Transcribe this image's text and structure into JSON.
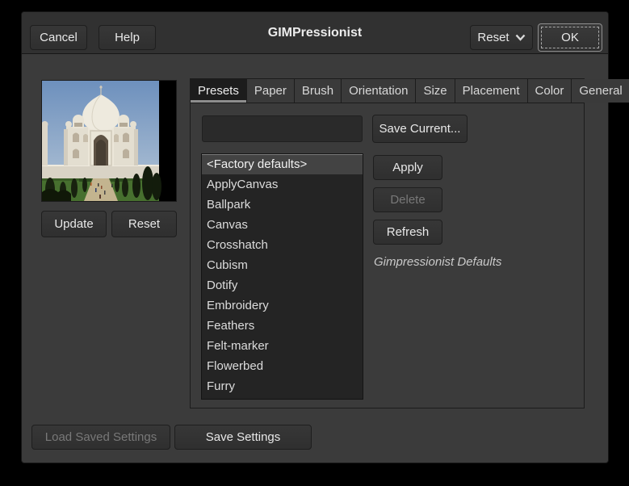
{
  "window": {
    "title": "GIMPressionist"
  },
  "header": {
    "cancel_label": "Cancel",
    "help_label": "Help",
    "reset_label": "Reset",
    "ok_label": "OK"
  },
  "preview": {
    "update_label": "Update",
    "reset_label": "Reset",
    "image_description": "taj-mahal-photo"
  },
  "tabs": [
    {
      "label": "Presets",
      "active": true
    },
    {
      "label": "Paper",
      "active": false
    },
    {
      "label": "Brush",
      "active": false
    },
    {
      "label": "Orientation",
      "active": false
    },
    {
      "label": "Size",
      "active": false
    },
    {
      "label": "Placement",
      "active": false
    },
    {
      "label": "Color",
      "active": false
    },
    {
      "label": "General",
      "active": false
    }
  ],
  "presets_tab": {
    "preset_name_value": "",
    "save_current_label": "Save Current...",
    "apply_label": "Apply",
    "delete_label": "Delete",
    "delete_enabled": false,
    "refresh_label": "Refresh",
    "description": "Gimpressionist Defaults",
    "selected_preset": "<Factory defaults>",
    "preset_list": [
      "<Factory defaults>",
      "ApplyCanvas",
      "Ballpark",
      "Canvas",
      "Crosshatch",
      "Cubism",
      "Dotify",
      "Embroidery",
      "Feathers",
      "Felt-marker",
      "Flowerbed",
      "Furry"
    ]
  },
  "footer": {
    "load_settings_label": "Load Saved Settings",
    "load_settings_enabled": false,
    "save_settings_label": "Save Settings"
  },
  "colors": {
    "desktop_bg": "#000000",
    "window_bg": "#3b3b3b",
    "headerbar_bg": "#313131",
    "button_bg": "#333333",
    "list_bg": "#242424",
    "selected_row_bg": "#434343",
    "active_tab_bg": "#1c1c1c",
    "active_tab_underline": "#8e8e8e",
    "text": "#e8e8e8",
    "disabled_text": "#787878"
  }
}
